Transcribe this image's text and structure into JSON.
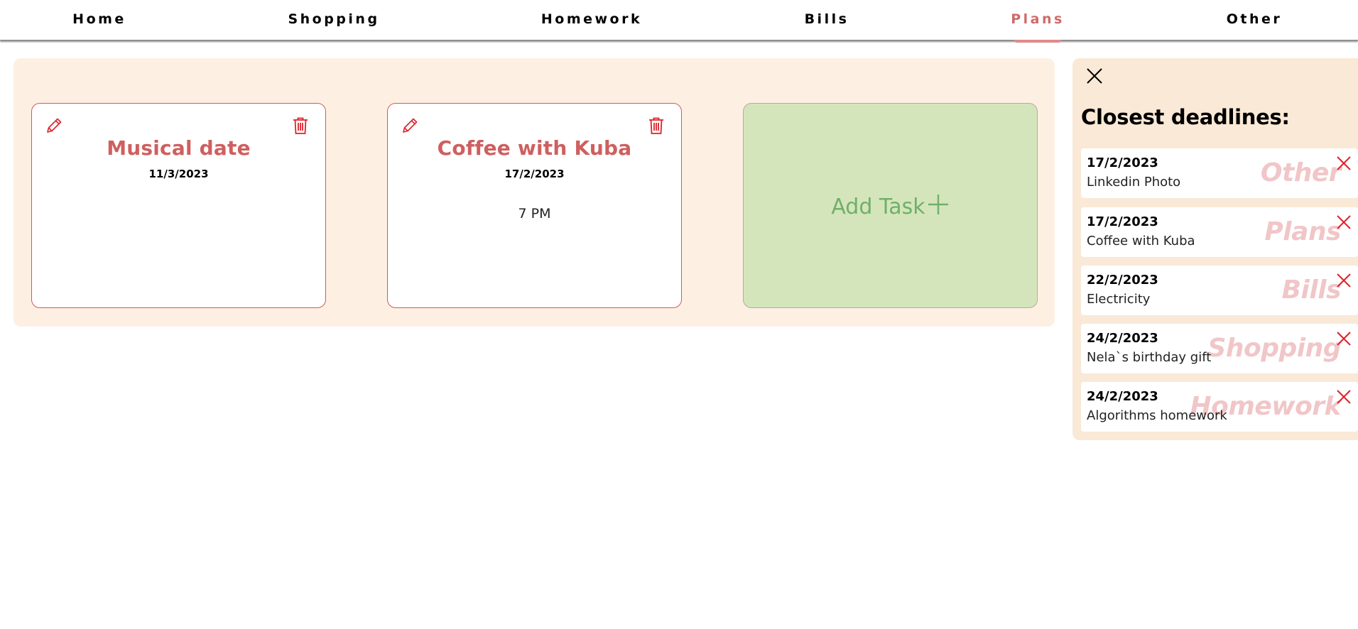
{
  "nav": {
    "items": [
      {
        "label": "Home"
      },
      {
        "label": "Shopping"
      },
      {
        "label": "Homework"
      },
      {
        "label": "Bills"
      },
      {
        "label": "Plans"
      },
      {
        "label": "Other"
      }
    ],
    "active": "Plans"
  },
  "tasks": [
    {
      "title": "Musical date",
      "date": "11/3/2023",
      "description": ""
    },
    {
      "title": "Coffee with Kuba",
      "date": "17/2/2023",
      "description": "7 PM"
    }
  ],
  "add_task": {
    "label": "Add Task",
    "icon": "plus-icon"
  },
  "sidebar": {
    "title": "Closest deadlines:",
    "deadlines": [
      {
        "date": "17/2/2023",
        "name": "Linkedin Photo",
        "category": "Other"
      },
      {
        "date": "17/2/2023",
        "name": "Coffee with Kuba",
        "category": "Plans"
      },
      {
        "date": "22/2/2023",
        "name": "Electricity",
        "category": "Bills"
      },
      {
        "date": "24/2/2023",
        "name": "Nela`s birthday gift",
        "category": "Shopping"
      },
      {
        "date": "24/2/2023",
        "name": "Algorithms homework",
        "category": "Homework"
      }
    ]
  },
  "colors": {
    "accent": "#cf5f5f",
    "danger": "#e0202a",
    "panel_bg": "#fdf0e3",
    "sidebar_bg": "#f9e9d6",
    "add_task_bg": "#d5e5bb",
    "add_task_text": "#6fb06a",
    "category_watermark": "#f1c6c8"
  }
}
